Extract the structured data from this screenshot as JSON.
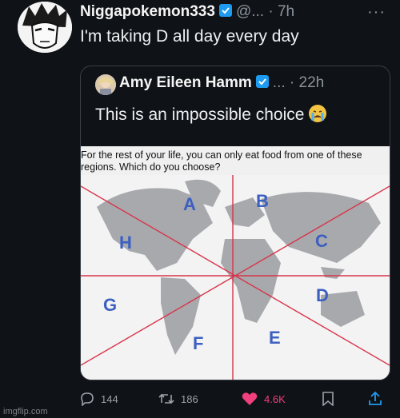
{
  "tweet": {
    "author_name": "Niggapokemon333",
    "author_handle": "@...",
    "time": "· 7h",
    "text": "I'm taking D all day every day",
    "more_label": "···"
  },
  "quote": {
    "author_name": "Amy Eileen Hamm",
    "author_handle": "...",
    "time": "· 22h",
    "text": "This is an impossible choice",
    "image_caption": "For the rest of your life, you can only eat food from one of these regions. Which do you choose?",
    "region_labels": [
      "A",
      "B",
      "C",
      "D",
      "E",
      "F",
      "G",
      "H"
    ]
  },
  "actions": {
    "replies": "144",
    "retweets": "186",
    "likes": "4.6K"
  },
  "watermark": "imgflip.com",
  "colors": {
    "background": "#0f1216",
    "verified": "#1d9bf0",
    "like": "#f0407d",
    "region_label": "#3c5fc0",
    "divider": "#d8344a"
  }
}
